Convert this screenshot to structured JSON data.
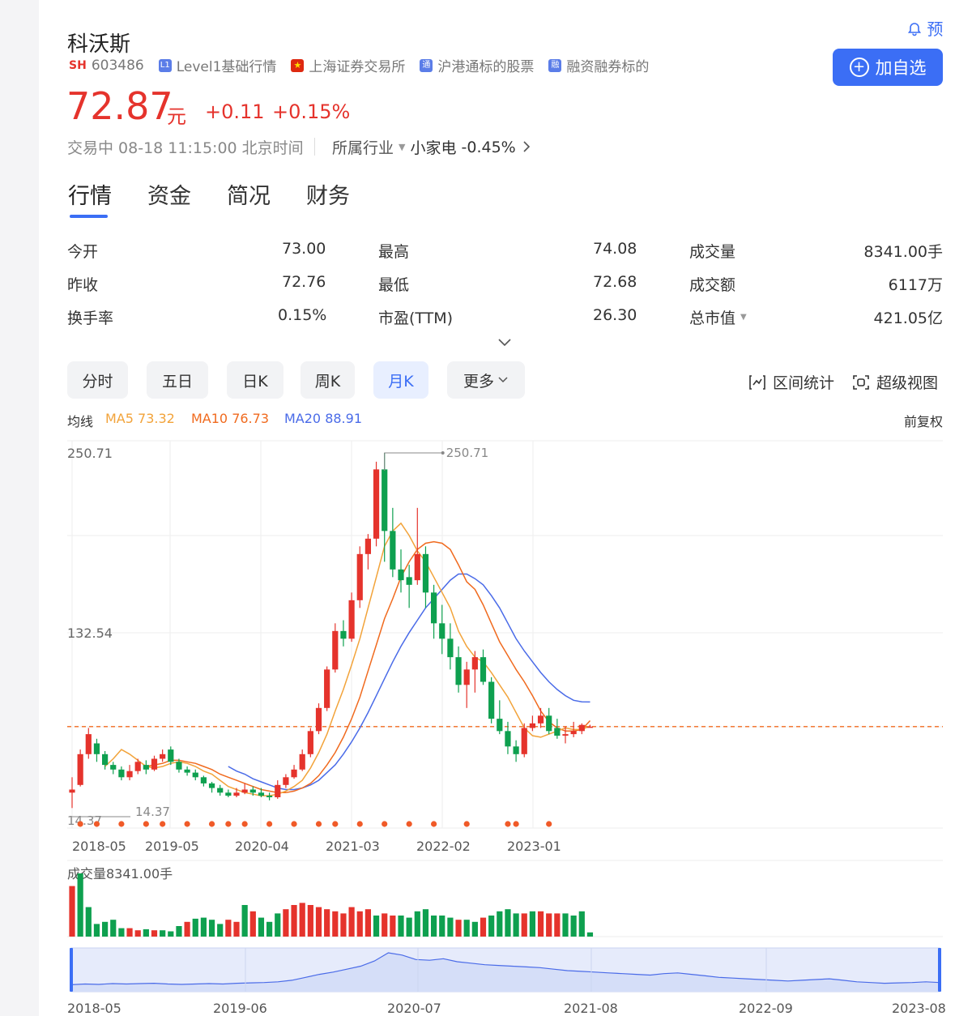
{
  "header": {
    "name": "科沃斯",
    "market": "SH",
    "code": "603486",
    "tags": [
      "Level1基础行情",
      "上海证券交易所",
      "沪港通标的股票",
      "融资融券标的"
    ],
    "alert_label": "预",
    "follow_label": "加自选"
  },
  "price": {
    "current": "72.87",
    "unit": "元",
    "change": "+0.11",
    "change_pct": "+0.15%",
    "status": "交易中 08-18 11:15:00 北京时间",
    "industry_label": "所属行业",
    "industry_name": "小家电",
    "industry_change": "-0.45%"
  },
  "tabs": [
    "行情",
    "资金",
    "简况",
    "财务"
  ],
  "quote": {
    "open_label": "今开",
    "open": "73.00",
    "prev_label": "昨收",
    "prev": "72.76",
    "turnover_label": "换手率",
    "turnover": "0.15%",
    "high_label": "最高",
    "high": "74.08",
    "low_label": "最低",
    "low": "72.68",
    "pe_label": "市盈(TTM)",
    "pe": "26.30",
    "volume_label": "成交量",
    "volume": "8341.00手",
    "amount_label": "成交额",
    "amount": "6117万",
    "cap_label": "总市值",
    "cap": "421.05亿"
  },
  "periods": [
    "分时",
    "五日",
    "日K",
    "周K",
    "月K",
    "更多"
  ],
  "selected_period": "月K",
  "tools": {
    "range_stats": "区间统计",
    "super_view": "超级视图"
  },
  "ma": {
    "label": "均线",
    "ma5": "MA5 73.32",
    "ma10": "MA10 76.73",
    "ma20": "MA20 88.91",
    "adjust": "前复权"
  },
  "colors": {
    "up": "#e5332c",
    "down": "#0ea04f",
    "accent": "#3b6ef5",
    "ma5": "#f2a33a",
    "ma10": "#f06a1e",
    "ma20": "#4a6be8"
  },
  "chart_data": {
    "type": "candlestick",
    "ylim": [
      14.37,
      250.71
    ],
    "y_ticks": [
      "250.71",
      "132.54"
    ],
    "max_label": "250.71",
    "min_label": "14.37",
    "min_axis_label": "14.37",
    "current_price": 72.87,
    "x_ticks": [
      "2018-05",
      "2019-05",
      "2020-04",
      "2021-03",
      "2022-02",
      "2023-01"
    ],
    "candles": [
      [
        30,
        32,
        40,
        20
      ],
      [
        35,
        55,
        58,
        34
      ],
      [
        55,
        68,
        72,
        52
      ],
      [
        62,
        55,
        65,
        50
      ],
      [
        55,
        48,
        57,
        45
      ],
      [
        48,
        45,
        50,
        42
      ],
      [
        45,
        40,
        47,
        38
      ],
      [
        40,
        44,
        48,
        38
      ],
      [
        44,
        50,
        52,
        42
      ],
      [
        48,
        45,
        51,
        42
      ],
      [
        45,
        52,
        54,
        44
      ],
      [
        52,
        55,
        58,
        50
      ],
      [
        58,
        50,
        60,
        48
      ],
      [
        50,
        45,
        52,
        43
      ],
      [
        45,
        43,
        47,
        41
      ],
      [
        43,
        40,
        45,
        38
      ],
      [
        40,
        36,
        41,
        34
      ],
      [
        36,
        33,
        37,
        30
      ],
      [
        33,
        30,
        35,
        28
      ],
      [
        30,
        28,
        32,
        27
      ],
      [
        28,
        30,
        33,
        27
      ],
      [
        30,
        32,
        36,
        29
      ],
      [
        32,
        30,
        34,
        28
      ],
      [
        30,
        28,
        33,
        27
      ],
      [
        28,
        27,
        30,
        25
      ],
      [
        27,
        35,
        38,
        26
      ],
      [
        35,
        40,
        42,
        33
      ],
      [
        40,
        45,
        48,
        39
      ],
      [
        45,
        55,
        58,
        44
      ],
      [
        55,
        70,
        72,
        53
      ],
      [
        70,
        85,
        88,
        68
      ],
      [
        85,
        110,
        112,
        83
      ],
      [
        110,
        135,
        140,
        108
      ],
      [
        135,
        130,
        142,
        125
      ],
      [
        130,
        155,
        160,
        128
      ],
      [
        155,
        185,
        190,
        150
      ],
      [
        185,
        195,
        198,
        175
      ],
      [
        195,
        240,
        245,
        190
      ],
      [
        240,
        200,
        250.71,
        180
      ],
      [
        200,
        175,
        215,
        170
      ],
      [
        175,
        168,
        188,
        160
      ],
      [
        170,
        165,
        178,
        150
      ],
      [
        168,
        185,
        215,
        165
      ],
      [
        185,
        160,
        190,
        150
      ],
      [
        160,
        140,
        165,
        130
      ],
      [
        140,
        130,
        152,
        120
      ],
      [
        130,
        118,
        140,
        110
      ],
      [
        118,
        100,
        125,
        95
      ],
      [
        100,
        110,
        115,
        85
      ],
      [
        110,
        118,
        122,
        95
      ],
      [
        118,
        102,
        123,
        100
      ],
      [
        102,
        78,
        105,
        75
      ],
      [
        78,
        70,
        90,
        68
      ],
      [
        70,
        60,
        76,
        55
      ],
      [
        60,
        55,
        64,
        50
      ],
      [
        55,
        72,
        75,
        53
      ],
      [
        72,
        75,
        80,
        70
      ],
      [
        75,
        80,
        85,
        72
      ],
      [
        80,
        70,
        85,
        68
      ],
      [
        72,
        67,
        78,
        65
      ],
      [
        67,
        68,
        73,
        62
      ],
      [
        68,
        70,
        76,
        66
      ],
      [
        70,
        74,
        75,
        68
      ],
      [
        72.76,
        72.87,
        74.08,
        72.68
      ]
    ],
    "ma5": [
      null,
      null,
      null,
      null,
      47,
      52,
      58,
      55,
      51,
      47,
      46,
      47,
      49,
      50,
      49,
      47,
      44,
      42,
      38,
      34,
      32,
      30,
      29,
      28,
      28,
      29,
      31,
      34,
      38,
      46,
      56,
      68,
      83,
      97,
      113,
      130,
      150,
      170,
      190,
      200,
      205,
      197,
      187,
      180,
      170,
      160,
      150,
      135,
      125,
      118,
      115,
      108,
      100,
      92,
      82,
      72,
      67,
      66,
      68,
      70,
      72,
      71,
      71,
      73.32
    ],
    "ma10": [
      null,
      null,
      null,
      null,
      null,
      null,
      null,
      null,
      null,
      47,
      48,
      49,
      51,
      51,
      50,
      49,
      47,
      45,
      42,
      40,
      38,
      36,
      34,
      32,
      31,
      30,
      30,
      31,
      33,
      36,
      41,
      48,
      56,
      66,
      78,
      92,
      109,
      126,
      143,
      156,
      170,
      180,
      188,
      192,
      193,
      192,
      188,
      178,
      167,
      162,
      152,
      140,
      128,
      119,
      110,
      102,
      93,
      83,
      76,
      72,
      70,
      70,
      71,
      76.73
    ],
    "ma20": [
      null,
      null,
      null,
      null,
      null,
      null,
      null,
      null,
      null,
      null,
      null,
      null,
      null,
      null,
      null,
      null,
      null,
      null,
      null,
      47,
      44,
      42,
      39,
      37,
      35,
      33,
      32,
      32,
      33,
      35,
      38,
      43,
      48,
      55,
      63,
      72,
      82,
      93,
      104,
      115,
      125,
      134,
      142,
      150,
      156,
      162,
      168,
      172,
      172,
      169,
      165,
      158,
      150,
      140,
      130,
      122,
      115,
      108,
      102,
      97,
      93,
      90,
      89,
      88.91
    ],
    "markers_x": [
      1,
      3,
      6,
      9,
      11,
      14,
      17,
      19,
      21,
      24,
      27,
      30,
      32,
      35,
      38,
      41,
      44,
      48,
      53,
      54,
      58
    ],
    "volume_label": "成交量8341.00手",
    "volume": [
      [
        48,
        "up"
      ],
      [
        60,
        "down"
      ],
      [
        28,
        "down"
      ],
      [
        12,
        "down"
      ],
      [
        14,
        "down"
      ],
      [
        16,
        "down"
      ],
      [
        8,
        "down"
      ],
      [
        8,
        "up"
      ],
      [
        6,
        "up"
      ],
      [
        7,
        "down"
      ],
      [
        6,
        "up"
      ],
      [
        6,
        "down"
      ],
      [
        5,
        "down"
      ],
      [
        10,
        "down"
      ],
      [
        14,
        "up"
      ],
      [
        17,
        "down"
      ],
      [
        18,
        "down"
      ],
      [
        16,
        "down"
      ],
      [
        12,
        "down"
      ],
      [
        16,
        "up"
      ],
      [
        14,
        "up"
      ],
      [
        30,
        "down"
      ],
      [
        24,
        "up"
      ],
      [
        18,
        "down"
      ],
      [
        14,
        "down"
      ],
      [
        22,
        "down"
      ],
      [
        26,
        "up"
      ],
      [
        30,
        "up"
      ],
      [
        32,
        "up"
      ],
      [
        30,
        "up"
      ],
      [
        28,
        "up"
      ],
      [
        26,
        "up"
      ],
      [
        24,
        "up"
      ],
      [
        22,
        "up"
      ],
      [
        28,
        "up"
      ],
      [
        24,
        "up"
      ],
      [
        26,
        "up"
      ],
      [
        20,
        "down"
      ],
      [
        22,
        "up"
      ],
      [
        20,
        "up"
      ],
      [
        20,
        "down"
      ],
      [
        18,
        "down"
      ],
      [
        24,
        "down"
      ],
      [
        26,
        "down"
      ],
      [
        20,
        "down"
      ],
      [
        20,
        "down"
      ],
      [
        18,
        "down"
      ],
      [
        16,
        "up"
      ],
      [
        16,
        "down"
      ],
      [
        14,
        "down"
      ],
      [
        18,
        "up"
      ],
      [
        20,
        "down"
      ],
      [
        24,
        "down"
      ],
      [
        26,
        "down"
      ],
      [
        22,
        "down"
      ],
      [
        22,
        "up"
      ],
      [
        24,
        "down"
      ],
      [
        24,
        "up"
      ],
      [
        22,
        "up"
      ],
      [
        22,
        "up"
      ],
      [
        22,
        "down"
      ],
      [
        20,
        "down"
      ],
      [
        24,
        "down"
      ],
      [
        4,
        "down"
      ]
    ],
    "navigator_x": [
      "2018-05",
      "2019-06",
      "2020-07",
      "2021-08",
      "2022-09",
      "2023-08"
    ],
    "navigator_values": [
      10,
      12,
      11,
      13,
      12,
      13,
      14,
      12,
      11,
      12,
      13,
      12,
      14,
      15,
      16,
      18,
      22,
      30,
      38,
      44,
      52,
      60,
      74,
      96,
      90,
      78,
      76,
      80,
      72,
      68,
      64,
      62,
      60,
      58,
      56,
      52,
      48,
      46,
      44,
      42,
      40,
      38,
      36,
      40,
      42,
      38,
      34,
      30,
      28,
      26,
      24,
      22,
      20,
      22,
      24,
      26,
      22,
      18,
      16,
      14,
      15,
      16,
      18,
      16
    ]
  }
}
